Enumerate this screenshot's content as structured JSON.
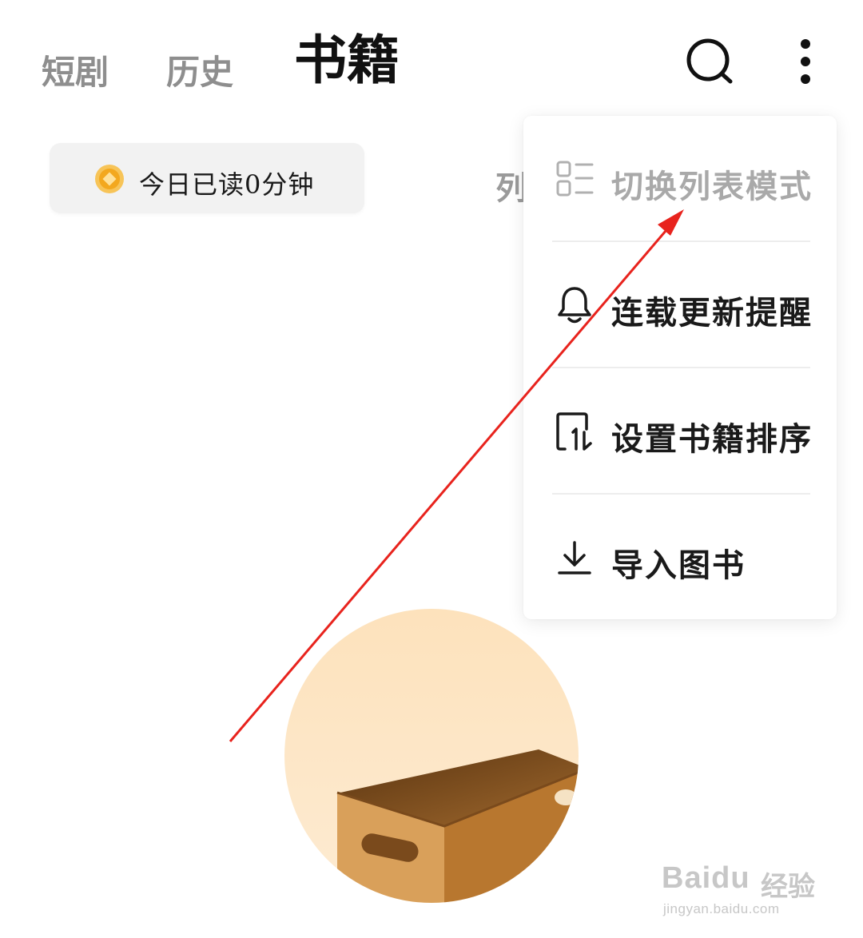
{
  "header": {
    "tabs": [
      {
        "label": "短剧",
        "active": false
      },
      {
        "label": "历史",
        "active": false
      },
      {
        "label": "书籍",
        "active": true
      }
    ],
    "icons": [
      "search-icon",
      "more-vertical-icon"
    ]
  },
  "reading_badge": {
    "icon": "coin-icon",
    "label": "今日已读0分钟"
  },
  "partial_text": "列",
  "dropdown_menu": {
    "items": [
      {
        "icon": "list-mode-icon",
        "label": "切换列表模式",
        "dimmed": true
      },
      {
        "icon": "bell-icon",
        "label": "连载更新提醒",
        "dimmed": false
      },
      {
        "icon": "sort-icon",
        "label": "设置书籍排序",
        "dimmed": false
      },
      {
        "icon": "download-icon",
        "label": "导入图书",
        "dimmed": false
      }
    ]
  },
  "empty_state": {
    "illustration": "empty-box-illustration"
  },
  "annotation": {
    "type": "red-arrow",
    "color": "#e8231d"
  },
  "watermark": {
    "brand": "Baidu",
    "brand_cn": "经验",
    "url": "jingyan.baidu.com"
  },
  "colors": {
    "tab_inactive": "#8e8e8e",
    "tab_active": "#111111",
    "coin": "#f3b23a",
    "illustration_bg": "#fde7c4",
    "box": "#c9893f"
  }
}
